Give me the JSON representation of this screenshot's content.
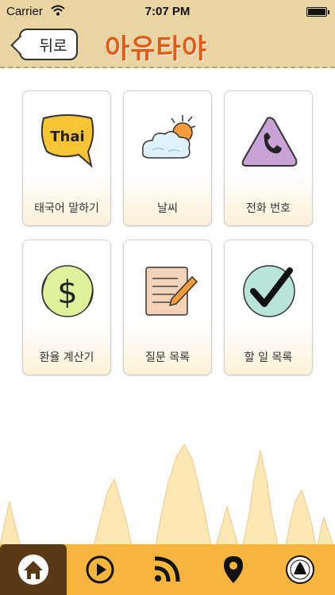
{
  "status_bar": {
    "carrier": "Carrier",
    "time": "7:07 PM"
  },
  "nav": {
    "back_label": "뒤로",
    "title": "아유타야"
  },
  "menu": {
    "items": [
      {
        "label": "태국어 말하기",
        "icon": "thai-speech-bubble-icon",
        "icon_text": "Thai"
      },
      {
        "label": "날씨",
        "icon": "weather-icon"
      },
      {
        "label": "전화 번호",
        "icon": "phone-icon"
      },
      {
        "label": "환율 계산기",
        "icon": "currency-icon"
      },
      {
        "label": "질문 목록",
        "icon": "notepad-icon"
      },
      {
        "label": "할 일 목록",
        "icon": "checkmark-icon"
      }
    ]
  },
  "tab_bar": {
    "tabs": [
      {
        "icon": "home-icon",
        "active": true
      },
      {
        "icon": "play-icon",
        "active": false
      },
      {
        "icon": "rss-icon",
        "active": false
      },
      {
        "icon": "location-pin-icon",
        "active": false
      },
      {
        "icon": "seal-icon",
        "active": false
      }
    ]
  },
  "colors": {
    "header": "#e9d4a4",
    "title": "#e55a12",
    "tab_bar": "#f6b53c",
    "tab_active": "#5a3a16"
  }
}
